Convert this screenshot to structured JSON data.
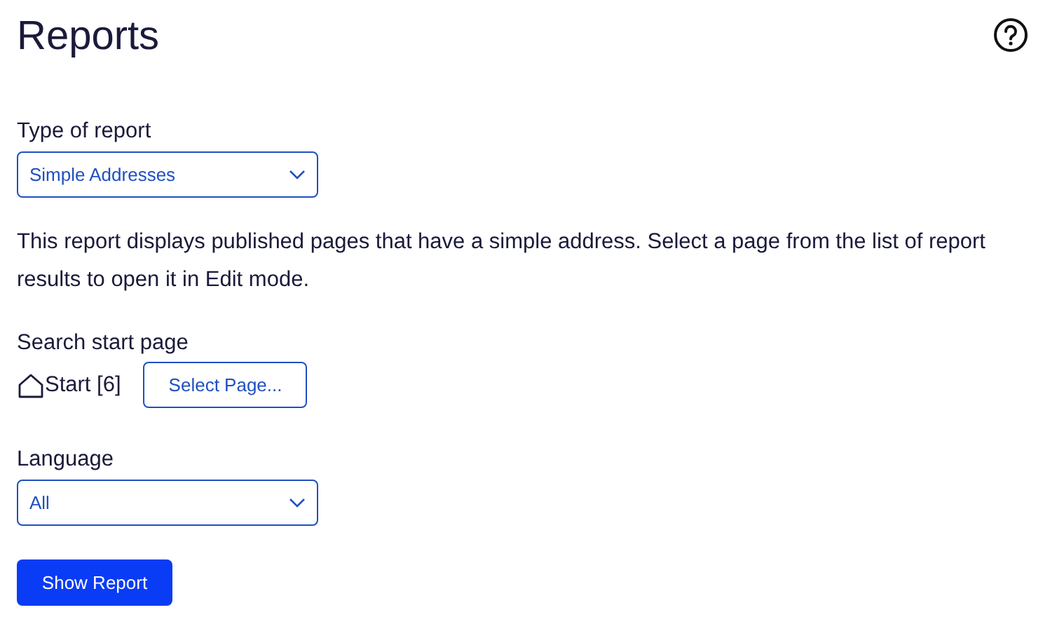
{
  "title": "Reports",
  "report_type": {
    "label": "Type of report",
    "value": "Simple Addresses"
  },
  "description": "This report displays published pages that have a simple address. Select a page from the list of report results to open it in Edit mode.",
  "start_page": {
    "label": "Search start page",
    "value": "Start [6]",
    "button": "Select Page..."
  },
  "language": {
    "label": "Language",
    "value": "All"
  },
  "submit": "Show Report"
}
